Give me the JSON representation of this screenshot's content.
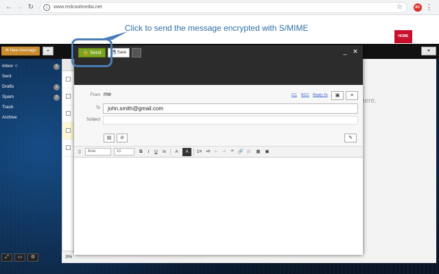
{
  "browser": {
    "back_glyph": "←",
    "forward_glyph": "→",
    "reload_glyph": "↻",
    "info_glyph": "i",
    "url": "www.redcoolmedia.net",
    "star_glyph": "☆",
    "extension_label": "RC",
    "menu_glyph": "⋮"
  },
  "page": {
    "home_button": "HOME"
  },
  "callout": {
    "text": "Click to send the message encrypted with S/MIME",
    "color": "#2f6fa8"
  },
  "app_header": {
    "new_message_label": "✉ New message",
    "header_icon_glyph": "▪",
    "user_icon_glyph": "▾"
  },
  "sidebar": {
    "items": [
      {
        "label": "Inbox ☆",
        "count": "1"
      },
      {
        "label": "Sent",
        "count": ""
      },
      {
        "label": "Drafts",
        "count": "1"
      },
      {
        "label": "Spam",
        "count": "2"
      },
      {
        "label": "Trash",
        "count": ""
      },
      {
        "label": "Archive",
        "count": ""
      }
    ],
    "footer_icons": [
      "expand-icon",
      "folder-icon",
      "gear-icon"
    ]
  },
  "message_list": {
    "zoom": "3%"
  },
  "reading_pane": {
    "empty_text": "here."
  },
  "compose": {
    "send_label": "🔒 Send",
    "save_label": "💾 Save",
    "minimize_glyph": "_",
    "close_glyph": "✕",
    "from_label": "From",
    "from_value": "me",
    "cc_link": "CC",
    "bcc_link": "BCC",
    "reply_to_link": "Reply-To",
    "to_label": "To",
    "to_value": "john.smith@gmail.com",
    "subject_label": "Subject",
    "subject_value": "",
    "toolbar": {
      "font": "Arial",
      "size": "13",
      "bold": "B",
      "italic": "I",
      "underline": "U",
      "strike": "Ix",
      "font_color": "A",
      "bg_color": "A",
      "ordered_list": "1≡",
      "bullet_list": "•≡",
      "quote": "❝",
      "link": "🔗",
      "table": "▦",
      "image": "▣"
    }
  },
  "colors": {
    "send_green": "#7aa31f",
    "new_message_orange": "#c98b2b",
    "home_red": "#c8102e",
    "callout_blue": "#4a7db5"
  }
}
